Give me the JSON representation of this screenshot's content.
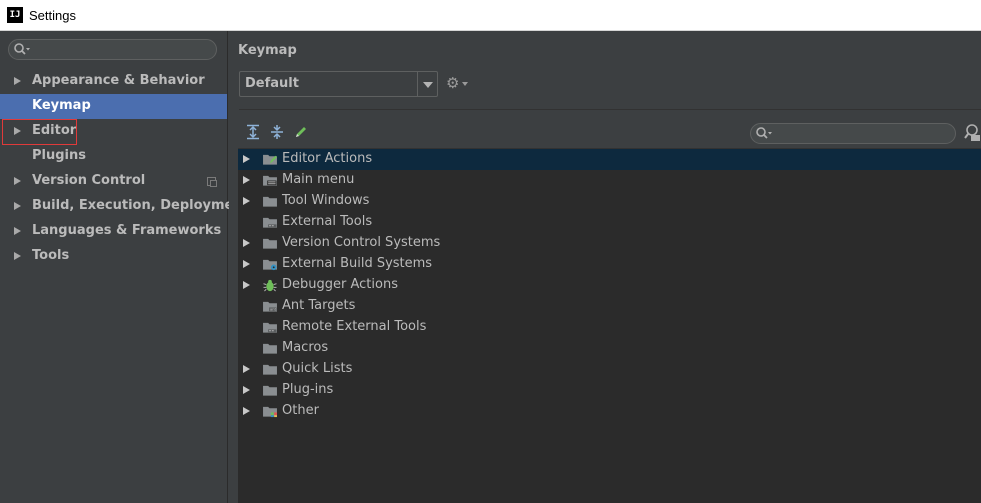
{
  "window": {
    "title": "Settings",
    "app_icon": "IJ"
  },
  "sidebar": {
    "search": {
      "value": "",
      "icon": "search-icon"
    },
    "items": [
      {
        "label": "Appearance & Behavior",
        "expandable": true,
        "selected": false
      },
      {
        "label": "Keymap",
        "expandable": false,
        "selected": true
      },
      {
        "label": "Editor",
        "expandable": true,
        "selected": false,
        "highlighted": true
      },
      {
        "label": "Plugins",
        "expandable": false,
        "selected": false
      },
      {
        "label": "Version Control",
        "expandable": true,
        "selected": false,
        "project_icon": true
      },
      {
        "label": "Build, Execution, Deployment",
        "expandable": true,
        "selected": false
      },
      {
        "label": "Languages & Frameworks",
        "expandable": true,
        "selected": false
      },
      {
        "label": "Tools",
        "expandable": true,
        "selected": false
      }
    ]
  },
  "main": {
    "title": "Keymap",
    "keymap_select": {
      "value": "Default"
    },
    "toolbar": {
      "buttons": [
        "expand-all-icon",
        "collapse-all-icon",
        "edit-icon"
      ]
    },
    "tree_search": {
      "value": ""
    },
    "tree": [
      {
        "label": "Editor Actions",
        "expandable": true,
        "selected": true,
        "icon": "editor-actions-folder-icon"
      },
      {
        "label": "Main menu",
        "expandable": true,
        "selected": false,
        "icon": "menu-folder-icon"
      },
      {
        "label": "Tool Windows",
        "expandable": true,
        "selected": false,
        "icon": "folder-icon"
      },
      {
        "label": "External Tools",
        "expandable": false,
        "selected": false,
        "icon": "tools-folder-icon"
      },
      {
        "label": "Version Control Systems",
        "expandable": true,
        "selected": false,
        "icon": "folder-icon"
      },
      {
        "label": "External Build Systems",
        "expandable": true,
        "selected": false,
        "icon": "build-folder-icon"
      },
      {
        "label": "Debugger Actions",
        "expandable": true,
        "selected": false,
        "icon": "bug-icon"
      },
      {
        "label": "Ant Targets",
        "expandable": false,
        "selected": false,
        "icon": "ant-folder-icon"
      },
      {
        "label": "Remote External Tools",
        "expandable": false,
        "selected": false,
        "icon": "tools-folder-icon"
      },
      {
        "label": "Macros",
        "expandable": false,
        "selected": false,
        "icon": "folder-icon"
      },
      {
        "label": "Quick Lists",
        "expandable": true,
        "selected": false,
        "icon": "folder-icon"
      },
      {
        "label": "Plug-ins",
        "expandable": true,
        "selected": false,
        "icon": "folder-icon"
      },
      {
        "label": "Other",
        "expandable": true,
        "selected": false,
        "icon": "other-folder-icon"
      }
    ]
  },
  "colors": {
    "background": "#3c3f41",
    "tree_background": "#2b2b2b",
    "selection": "#4b6eaf",
    "tree_selection": "#0d293e",
    "highlight_border": "#e03a3a",
    "text": "#bbbbbb"
  }
}
